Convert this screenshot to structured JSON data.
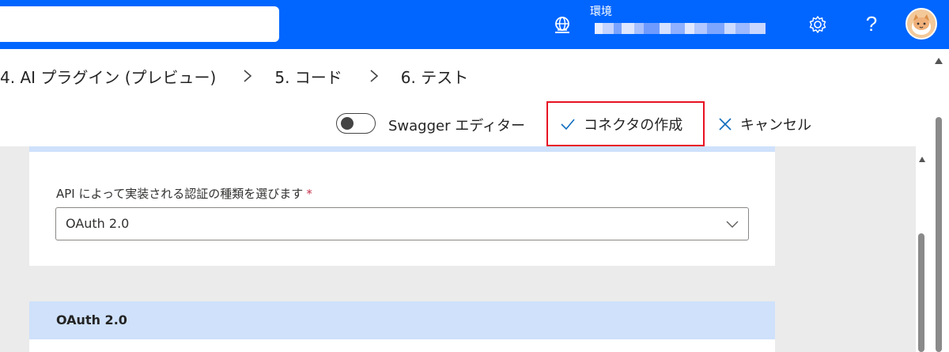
{
  "header": {
    "search_placeholder": "",
    "environment_label": "環境",
    "help_label": "?"
  },
  "steps": [
    {
      "label": "4. AI プラグイン (プレビュー)"
    },
    {
      "label": "5. コード"
    },
    {
      "label": "6. テスト"
    }
  ],
  "toolbar": {
    "swagger_label": "Swagger エディター",
    "create_label": "コネクタの作成",
    "cancel_label": "キャンセル"
  },
  "auth": {
    "label": "API によって実装される認証の種類を選びます",
    "required_mark": "*",
    "selected_value": "OAuth 2.0"
  },
  "oauth_section": {
    "title": "OAuth 2.0"
  },
  "colors": {
    "header_blue": "#0066ff",
    "highlight_red": "#e81123",
    "section_blue": "#cfe1fb",
    "icon_blue": "#0f6cbd"
  }
}
